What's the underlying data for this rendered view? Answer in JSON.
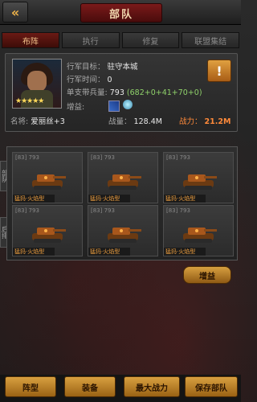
{
  "header": {
    "title": "部队",
    "back_icon": "double-chevron-left-icon"
  },
  "tabs": [
    {
      "label": "布阵",
      "active": true
    },
    {
      "label": "执行",
      "active": false
    },
    {
      "label": "修复",
      "active": false
    },
    {
      "label": "联盟集结",
      "active": false
    }
  ],
  "info": {
    "target_label": "行军目标：",
    "target_value": "驻守本城",
    "time_label": "行军时间：",
    "time_value": "0",
    "capacity_label": "单支带兵量:",
    "capacity_value": "793",
    "capacity_breakdown": "(682+0+41+70+0)",
    "bonus_label": "增益:",
    "name_label": "名将:",
    "name_value": "爱丽丝+3",
    "strength_label": "战量：",
    "strength_value": "128.4M",
    "power_label": "战力：",
    "power_value": "21.2M",
    "stars": "★★★★★",
    "alert_symbol": "!"
  },
  "side_tabs": {
    "upper": "部队",
    "lower": "后排"
  },
  "units": [
    {
      "count": "[83] 793",
      "name": "猛犸·火焰型"
    },
    {
      "count": "[83] 793",
      "name": "猛犸·火焰型"
    },
    {
      "count": "[83] 793",
      "name": "猛犸·火焰型"
    },
    {
      "count": "[83] 793",
      "name": "猛犸·火焰型"
    },
    {
      "count": "[83] 793",
      "name": "猛犸·火焰型"
    },
    {
      "count": "[83] 793",
      "name": "猛犸·火焰型"
    }
  ],
  "boost_button": "增益",
  "bottom_buttons": [
    "阵型",
    "装备",
    "最大战力",
    "保存部队"
  ],
  "colors": {
    "accent": "#d8a040",
    "power": "#ff8a3a",
    "tab_active": "#6a1a14"
  }
}
